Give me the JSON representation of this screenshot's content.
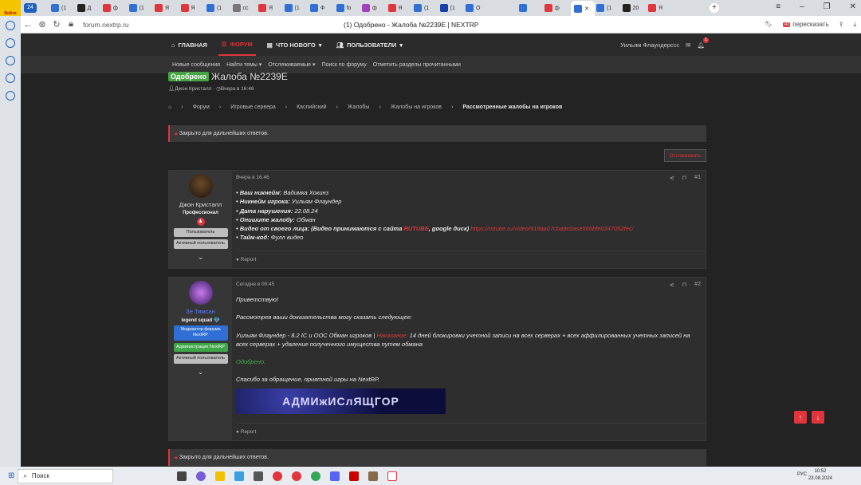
{
  "browser": {
    "profile_badge": "24",
    "window_title": "(1) Одобрено - Жалоба №2239E | NEXTRP",
    "url": "forum.nextrp.ru",
    "translate_label": "пересказать",
    "tabs": [
      {
        "label": "(1",
        "color": "#2f6fd6"
      },
      {
        "label": "Д",
        "color": "#222"
      },
      {
        "label": "ф",
        "color": "#e0353d"
      },
      {
        "label": "(1",
        "color": "#2f6fd6"
      },
      {
        "label": "Я",
        "color": "#e0353d"
      },
      {
        "label": "Я",
        "color": "#e0353d"
      },
      {
        "label": "(1",
        "color": "#2f6fd6"
      },
      {
        "label": "cc",
        "color": "#777"
      },
      {
        "label": "Я",
        "color": "#e0353d"
      },
      {
        "label": "(1",
        "color": "#2f6fd6"
      },
      {
        "label": "Ф",
        "color": "#2f6fd6"
      },
      {
        "label": "fo",
        "color": "#2f6fd6"
      },
      {
        "label": "ф",
        "color": "#a040c0"
      },
      {
        "label": "Я",
        "color": "#e0353d"
      },
      {
        "label": "(1",
        "color": "#2f6fd6"
      },
      {
        "label": "(1",
        "color": "#1a3fa8"
      },
      {
        "label": "O",
        "color": "#2f6fd6"
      },
      {
        "label": "",
        "color": "#2f6fd6"
      },
      {
        "label": "ф",
        "color": "#e0353d"
      },
      {
        "label": "(1",
        "color": "#2f6fd6"
      },
      {
        "label": "(1",
        "color": "#2f6fd6"
      },
      {
        "label": "20",
        "color": "#222"
      },
      {
        "label": "Я",
        "color": "#e0353d"
      }
    ]
  },
  "nav": {
    "items": [
      "ГЛАВНАЯ",
      "ФОРУМ",
      "ЧТО НОВОГО",
      "ПОЛЬЗОВАТЕЛИ"
    ],
    "user": "Уильям Флаундерссс",
    "notif_count": "1"
  },
  "subnav": [
    "Новые сообщения",
    "Найти темы",
    "Отслеживаемые",
    "Поиск по форуму",
    "Отметить разделы прочитанными"
  ],
  "thread": {
    "prefix": "Одобрено",
    "title": "Жалоба №2239E",
    "author": "Джон Кристалл",
    "date": "Вчера в 16:46",
    "breadcrumb": [
      "Форум",
      "Игровые сервера",
      "Каспийский",
      "Жалобы",
      "Жалобы на игроков",
      "Рассмотренные жалобы на игроков"
    ],
    "closed_notice": "Закрыто для дальнейших ответов.",
    "watch_label": "Отслеживать"
  },
  "posts": [
    {
      "user": "Джон Кристалл",
      "title": "Профессионал",
      "banners": [
        "Пользователь",
        "Активный пользователь"
      ],
      "date": "Вчера в 16:46",
      "num": "#1",
      "report": "Report",
      "lines": [
        {
          "label": "• Ваш никнейм:",
          "value": " Вадимка Хокинз"
        },
        {
          "label": "• Никнейм игрока:",
          "value": " Уильям Флаундер"
        },
        {
          "label": "• Дата нарушения:",
          "value": " 22.08.24"
        },
        {
          "label": "• Опишите жалобу:",
          "value": " Обман"
        }
      ],
      "video_label": "• Видео от своего лица:",
      "video_note_a": " (Видео принимаются с сайта ",
      "video_rutube": "RUTUBE",
      "video_note_b": ", google диск)",
      "video_link": "https://rutube.ru/video/919aa07cba9c0ase566bfe0347052fec/",
      "timecode_label": "• Тайм-код:",
      "timecode_value": " Фулл видео"
    },
    {
      "user": "Зе Тимсан",
      "title": "legend squad",
      "banners": [
        "Модератор форума NextRP",
        "Администрация NextRP",
        "Активный пользователь"
      ],
      "date": "Сегодня в 09:45",
      "num": "#2",
      "report": "Report",
      "greeting": "Приветствую!",
      "p1": "Рассмотрев ваши доказательства могу сказать следующее:",
      "p2a": "Уильям Флаундер - 8.2 IC и ООС Обман игроков | ",
      "p2b": "Наказание:",
      "p2c": " 14 дней блокировки учетной записи на всех серверах + всех аффилированных учетных записей на всех серверах + удаление полученного имущества путем обмана",
      "approved": "Одобрено.",
      "thanks": "Спасибо за обращение, приятной игры на NextRP.",
      "signature": "АДМИжИСлЯЩГОР"
    }
  ],
  "taskbar": {
    "search": "Поиск",
    "lang": "РУС",
    "time": "10:52",
    "date": "23.08.2024"
  }
}
